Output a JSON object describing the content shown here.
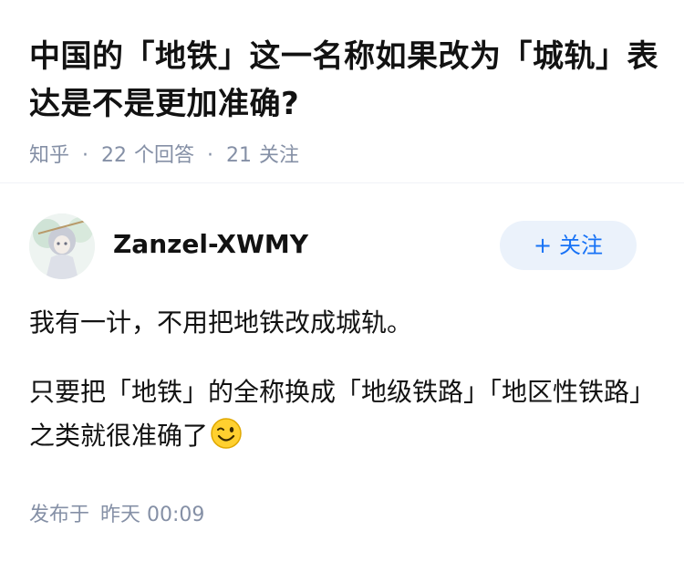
{
  "question": {
    "title": "中国的「地铁」这一名称如果改为「城轨」表达是不是更加准确?",
    "source": "知乎",
    "answers_count": "22",
    "answers_label": "个回答",
    "followers_count": "21",
    "followers_label": "关注"
  },
  "author": {
    "name": "Zanzel-XWMY",
    "follow_label": "关注",
    "follow_icon": "plus-icon"
  },
  "answer": {
    "paragraphs": [
      "我有一计，不用把地铁改成城轨。",
      "只要把「地铁」的全称换成「地级铁路」「地区性铁路」之类就很准确了"
    ],
    "emoji": "wink-emoji"
  },
  "posted": {
    "label": "发布于",
    "time": "昨天 00:09"
  },
  "colors": {
    "accent": "#1772f6",
    "follow_bg": "#ebf2fb",
    "meta_gray": "#8590a6"
  }
}
